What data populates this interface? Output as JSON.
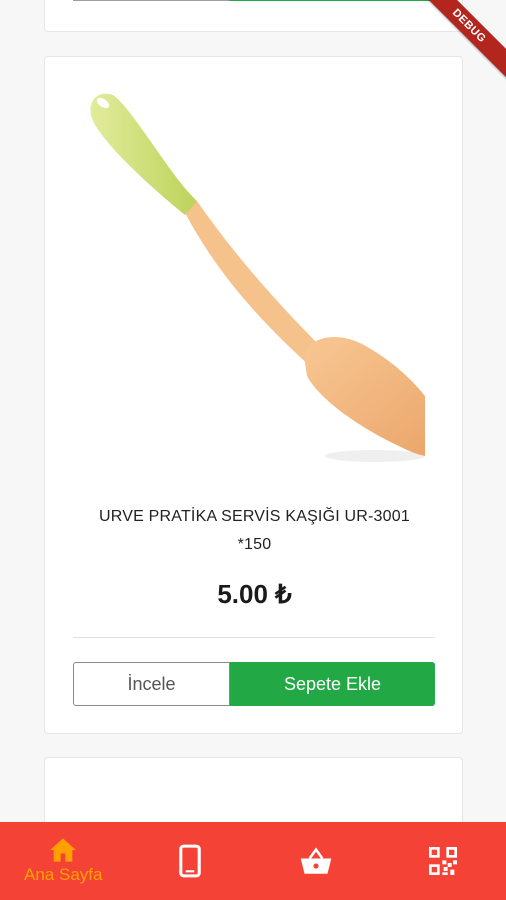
{
  "debug_banner": "DEBUG",
  "product": {
    "name_line1": "URVE PRATİKA SERVİS KAŞIĞI UR-3001",
    "name_line2": "*150",
    "price": "5.00 ₺",
    "inspect_label": "İncele",
    "add_to_cart_label": "Sepete Ekle"
  },
  "bottom_nav": {
    "items": [
      {
        "icon": "home-icon",
        "label": "Ana Sayfa",
        "active": true
      },
      {
        "icon": "phone-icon",
        "label": ""
      },
      {
        "icon": "basket-icon",
        "label": ""
      },
      {
        "icon": "qr-code-icon",
        "label": ""
      }
    ]
  },
  "colors": {
    "nav_background": "#f44336",
    "active_nav": "#ffa000",
    "add_to_cart": "#22a845",
    "card_background": "#ffffff"
  }
}
